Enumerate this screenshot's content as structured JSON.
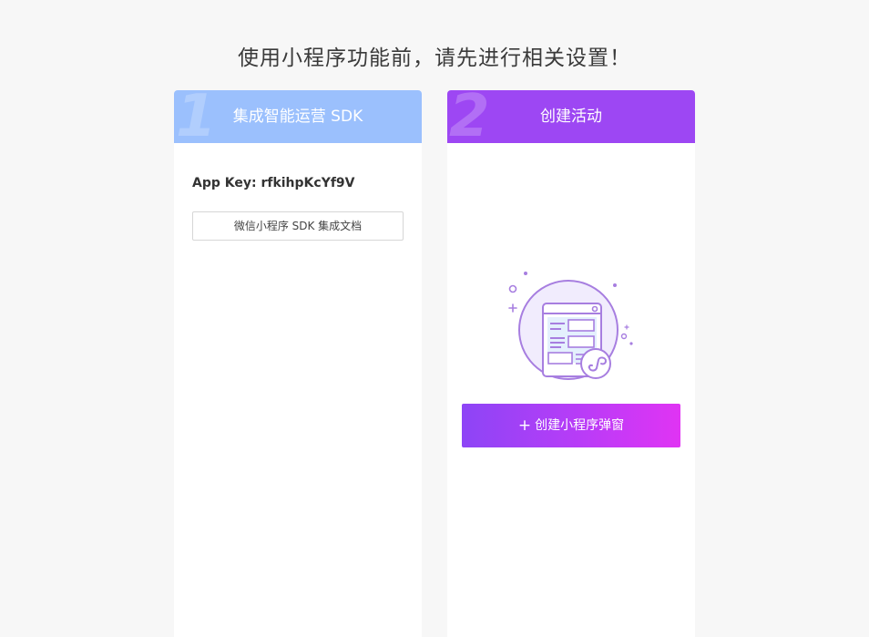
{
  "page": {
    "title": "使用小程序功能前，请先进行相关设置！"
  },
  "step1": {
    "number": "1",
    "title": "集成智能运营 SDK",
    "app_key": "App Key: rfkihpKcYf9V",
    "doc_button_label": "微信小程序 SDK 集成文档"
  },
  "step2": {
    "number": "2",
    "title": "创建活动",
    "illustration_icon": "mini-program-page-illustration",
    "create_button_icon": "plus-icon",
    "create_button_label": "创建小程序弹窗"
  },
  "colors": {
    "step1_header": "#9bc0fd",
    "step2_header": "#9d47f3",
    "button_gradient_start": "#8d45f6",
    "button_gradient_end": "#e034f4",
    "background": "#f7f7f7"
  }
}
